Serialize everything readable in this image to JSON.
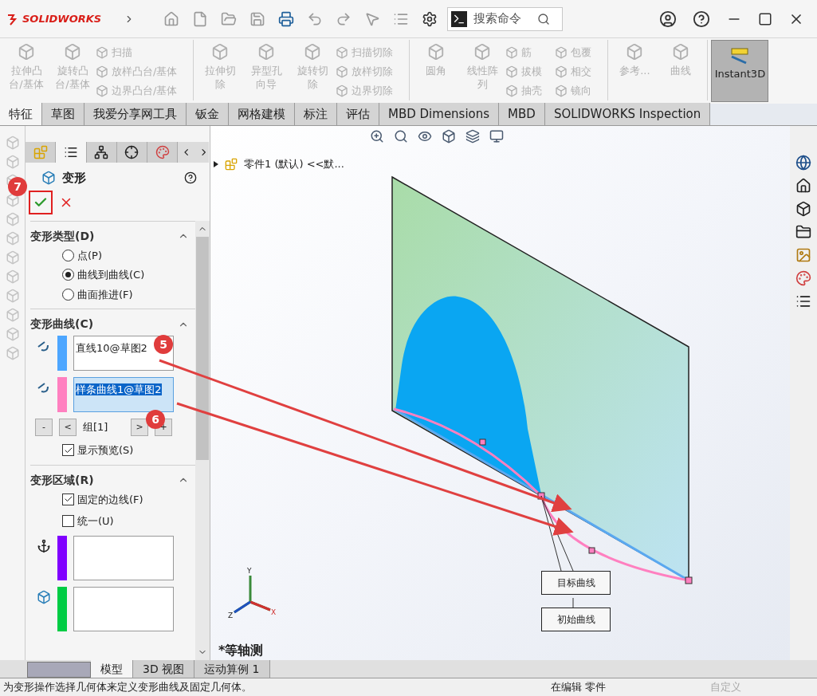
{
  "title_bar": {
    "logo": "SOLIDWORKS",
    "search": {
      "placeholder": "搜索命令"
    }
  },
  "ribbon": {
    "groups": [
      {
        "items": [
          {
            "kind": "large",
            "label": "拉伸凸台/基体",
            "disabled": true
          },
          {
            "kind": "large",
            "label": "旋转凸台/基体",
            "disabled": true
          },
          {
            "kind": "small",
            "label": "扫描",
            "disabled": true
          },
          {
            "kind": "small",
            "label": "放样凸台/基体",
            "disabled": true
          },
          {
            "kind": "small",
            "label": "边界凸台/基体",
            "disabled": true
          }
        ]
      },
      {
        "items": [
          {
            "kind": "large",
            "label": "拉伸切除",
            "disabled": true
          },
          {
            "kind": "large",
            "label": "异型孔向导",
            "disabled": true
          },
          {
            "kind": "large",
            "label": "旋转切除",
            "disabled": true
          },
          {
            "kind": "small",
            "label": "扫描切除",
            "disabled": true
          },
          {
            "kind": "small",
            "label": "放样切除",
            "disabled": true
          },
          {
            "kind": "small",
            "label": "边界切除",
            "disabled": true
          }
        ]
      },
      {
        "items": [
          {
            "kind": "large",
            "label": "圆角",
            "disabled": true
          },
          {
            "kind": "large",
            "label": "线性阵列",
            "disabled": true
          },
          {
            "kind": "small",
            "label": "筋",
            "disabled": true
          },
          {
            "kind": "small",
            "label": "拔模",
            "disabled": true
          },
          {
            "kind": "small",
            "label": "抽壳",
            "disabled": true
          },
          {
            "kind": "small",
            "label": "包覆",
            "disabled": true
          },
          {
            "kind": "small",
            "label": "相交",
            "disabled": true
          },
          {
            "kind": "small",
            "label": "镜向",
            "disabled": true
          }
        ]
      },
      {
        "items": [
          {
            "kind": "large",
            "label": "参考...",
            "disabled": true
          },
          {
            "kind": "large",
            "label": "曲线",
            "disabled": true
          }
        ]
      }
    ],
    "instant3d": {
      "label": "Instant3D",
      "selected": true
    }
  },
  "tabs": [
    {
      "label": "特征",
      "selected": true
    },
    {
      "label": "草图",
      "selected": false
    },
    {
      "label": "我爱分享网工具",
      "selected": false
    },
    {
      "label": "钣金",
      "selected": false
    },
    {
      "label": "网格建模",
      "selected": false
    },
    {
      "label": "标注",
      "selected": false
    },
    {
      "label": "评估",
      "selected": false
    },
    {
      "label": "MBD Dimensions",
      "selected": false
    },
    {
      "label": "MBD",
      "selected": false
    },
    {
      "label": "SOLIDWORKS Inspection",
      "selected": false
    }
  ],
  "property_manager": {
    "tabs": [
      {
        "kind": "feature",
        "selected": false
      },
      {
        "kind": "property",
        "selected": true
      },
      {
        "kind": "config",
        "selected": false
      },
      {
        "kind": "target",
        "selected": false
      },
      {
        "kind": "display",
        "selected": false
      }
    ],
    "title": "变形",
    "deform_type": {
      "title": "变形类型(D)",
      "options": [
        {
          "label": "点(P)",
          "selected": false
        },
        {
          "label": "曲线到曲线(C)",
          "selected": true
        },
        {
          "label": "曲面推进(F)",
          "selected": false
        }
      ]
    },
    "deform_curves": {
      "title": "变形曲线(C)",
      "curves": [
        {
          "value": "直线10@草图2",
          "color": "#4da6ff",
          "selected": false
        },
        {
          "value": "样条曲线1@草图2",
          "color": "#ff80c0",
          "selected": true
        }
      ],
      "buttons_before": [
        "-",
        "<"
      ],
      "group_label": "组[1]",
      "buttons_after": [
        ">",
        "+"
      ],
      "preview": {
        "label": "显示预览(S)",
        "checked": true
      }
    },
    "deform_region": {
      "title": "变形区域(R)",
      "options": [
        {
          "label": "固定的边线(F)",
          "checked": true
        },
        {
          "label": "统一(U)",
          "checked": false
        }
      ],
      "boxes": [
        {
          "kind": "anchor",
          "color": "#8000ff"
        },
        {
          "kind": "body",
          "color": "#00cc44"
        }
      ]
    }
  },
  "callouts": [
    "7",
    "5",
    "6"
  ],
  "graphics": {
    "tree_item": "零件1 (默认) <<默...",
    "labels": [
      "目标曲线",
      "初始曲线"
    ],
    "axes": [
      "X",
      "Y",
      "Z"
    ],
    "view_name": "*等轴测"
  },
  "bottom_tabs": [
    {
      "label": "模型",
      "selected": true
    },
    {
      "label": "3D 视图",
      "selected": false
    },
    {
      "label": "运动算例 1",
      "selected": false
    }
  ],
  "status_bar": {
    "message": "为变形操作选择几何体来定义变形曲线及固定几何体。",
    "mode": "在编辑 零件",
    "units": "自定义"
  }
}
